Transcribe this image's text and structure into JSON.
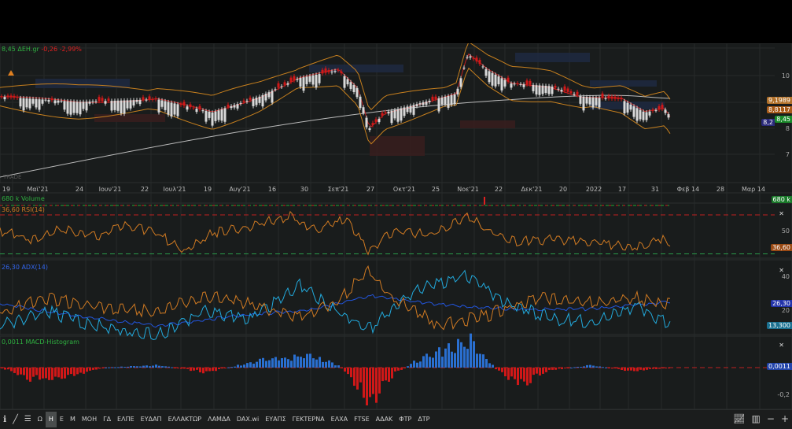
{
  "header": {
    "price": "8,45",
    "symbol": "ΔΕΗ.gr",
    "change": "-0,26",
    "change_pct": "-2,99%"
  },
  "price_axis": {
    "labels": [
      "10",
      "9",
      "8",
      "7"
    ],
    "tags": [
      {
        "text": "9,1989",
        "color": "#b0702a"
      },
      {
        "text": "8,8117",
        "color": "#a85a18"
      },
      {
        "text": "8,45",
        "color": "#1a8a2a"
      },
      {
        "text": "8,2",
        "color": "#2a2a7a"
      }
    ]
  },
  "x_axis": {
    "labels": [
      "19",
      "Μαϊ'21",
      "24",
      "Ιουν'21",
      "22",
      "Ιουλ'21",
      "19",
      "Αυγ'21",
      "16",
      "30",
      "Σεπ'21",
      "27",
      "Οκτ'21",
      "25",
      "Νοε'21",
      "22",
      "Δεκ'21",
      "20",
      "2022",
      "17",
      "31",
      "Φεβ 14",
      "28",
      "Μαρ 14"
    ]
  },
  "volume": {
    "label": "680 k Volume",
    "tag": "680 k"
  },
  "rsi": {
    "label": "36,60 RSI(14)",
    "axis": "50",
    "tag": "36,60"
  },
  "adx": {
    "label": "26,30 ADX(14)",
    "axis": [
      "40",
      "20"
    ],
    "tag1": "26,30",
    "tag2": "13,300"
  },
  "macd": {
    "label": "0,0011 MACD-Histogram",
    "tag": "0,0011",
    "axis": "-0,2"
  },
  "toolbar": {
    "items": [
      "Ω",
      "Η",
      "Ε",
      "Μ",
      "ΜΟΗ",
      "ΓΔ",
      "ΕΛΠΕ",
      "ΕΥΔΑΠ",
      "ΕΛΛΑΚΤΩΡ",
      "ΛΑΜΔΑ",
      "DAX.wi",
      "ΕΥΑΠΣ",
      "ΓΕΚΤΕΡΝΑ",
      "ΕΛΧΑ",
      "FTSE",
      "ΑΔΑΚ",
      "ΦΤΡ",
      "ΔΤΡ"
    ],
    "active": "Η"
  },
  "watermark": "TRADE",
  "colors": {
    "up": "#d8d8d8",
    "down": "#d01818",
    "volume": "#22aa33",
    "rsi": "#d07a22",
    "adx": "#2255dd",
    "di_plus": "#22aadd",
    "di_minus": "#d07a22",
    "macd_pos": "#2a6fd0",
    "macd_neg": "#d01818"
  },
  "chart_data": {
    "type": "line",
    "price_keypoints": [
      [
        0,
        9.2
      ],
      [
        100,
        9.0
      ],
      [
        200,
        9.1
      ],
      [
        270,
        8.6
      ],
      [
        330,
        9.2
      ],
      [
        380,
        9.9
      ],
      [
        430,
        10.2
      ],
      [
        455,
        9.5
      ],
      [
        470,
        8.0
      ],
      [
        490,
        8.6
      ],
      [
        540,
        9.0
      ],
      [
        580,
        9.3
      ],
      [
        595,
        10.8
      ],
      [
        620,
        10.2
      ],
      [
        650,
        9.7
      ],
      [
        700,
        9.6
      ],
      [
        740,
        9.2
      ],
      [
        790,
        9.1
      ],
      [
        820,
        8.6
      ],
      [
        845,
        8.75
      ],
      [
        852,
        8.45
      ]
    ],
    "rsi_keypoints": [
      [
        0,
        55
      ],
      [
        40,
        45
      ],
      [
        80,
        58
      ],
      [
        120,
        48
      ],
      [
        160,
        60
      ],
      [
        200,
        52
      ],
      [
        235,
        30
      ],
      [
        270,
        52
      ],
      [
        320,
        60
      ],
      [
        370,
        72
      ],
      [
        400,
        55
      ],
      [
        440,
        68
      ],
      [
        470,
        30
      ],
      [
        500,
        55
      ],
      [
        550,
        50
      ],
      [
        595,
        73
      ],
      [
        620,
        55
      ],
      [
        660,
        42
      ],
      [
        700,
        45
      ],
      [
        760,
        40
      ],
      [
        810,
        36
      ],
      [
        840,
        46
      ],
      [
        852,
        37
      ]
    ],
    "adx_keypoints": [
      [
        0,
        25
      ],
      [
        100,
        18
      ],
      [
        200,
        12
      ],
      [
        300,
        18
      ],
      [
        400,
        22
      ],
      [
        470,
        30
      ],
      [
        550,
        25
      ],
      [
        650,
        22
      ],
      [
        750,
        22
      ],
      [
        852,
        26.3
      ]
    ],
    "di_plus_keypoints": [
      [
        0,
        14
      ],
      [
        60,
        22
      ],
      [
        120,
        14
      ],
      [
        200,
        8
      ],
      [
        260,
        22
      ],
      [
        320,
        18
      ],
      [
        380,
        38
      ],
      [
        430,
        22
      ],
      [
        470,
        12
      ],
      [
        530,
        35
      ],
      [
        595,
        43
      ],
      [
        640,
        28
      ],
      [
        700,
        18
      ],
      [
        760,
        16
      ],
      [
        810,
        26
      ],
      [
        852,
        13.3
      ]
    ],
    "di_minus_keypoints": [
      [
        0,
        22
      ],
      [
        60,
        30
      ],
      [
        120,
        25
      ],
      [
        200,
        22
      ],
      [
        260,
        32
      ],
      [
        320,
        26
      ],
      [
        380,
        18
      ],
      [
        430,
        28
      ],
      [
        467,
        46
      ],
      [
        500,
        30
      ],
      [
        560,
        14
      ],
      [
        620,
        20
      ],
      [
        680,
        30
      ],
      [
        760,
        28
      ],
      [
        810,
        30
      ],
      [
        852,
        26
      ]
    ],
    "macd_keypoints": [
      [
        0,
        0.0
      ],
      [
        40,
        -0.1
      ],
      [
        80,
        -0.08
      ],
      [
        130,
        0.0
      ],
      [
        200,
        0.02
      ],
      [
        260,
        -0.04
      ],
      [
        330,
        0.06
      ],
      [
        390,
        0.1
      ],
      [
        430,
        0.02
      ],
      [
        470,
        -0.28
      ],
      [
        500,
        -0.05
      ],
      [
        540,
        0.1
      ],
      [
        598,
        0.22
      ],
      [
        630,
        -0.02
      ],
      [
        660,
        -0.14
      ],
      [
        700,
        -0.02
      ],
      [
        750,
        0.02
      ],
      [
        800,
        -0.03
      ],
      [
        852,
        0.0011
      ]
    ]
  }
}
